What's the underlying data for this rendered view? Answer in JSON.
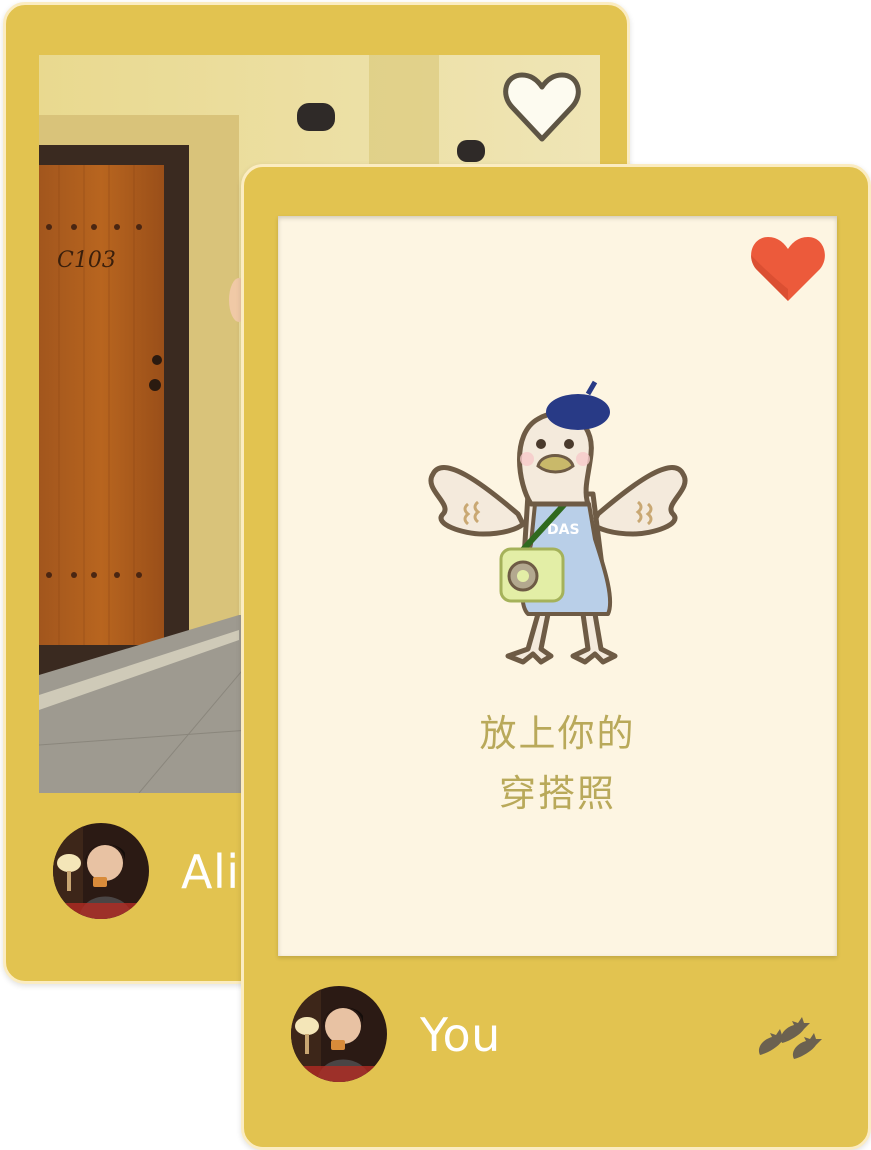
{
  "cards": [
    {
      "username": "Ali",
      "liked": false,
      "photo": "door-photo",
      "door_number": "C103"
    },
    {
      "username": "You",
      "liked": true,
      "placeholder_line1": "放上你的",
      "placeholder_line2": "穿搭照"
    }
  ],
  "colors": {
    "card_background": "#e2c350",
    "card_border": "#fbecc1",
    "liked_heart": "#ec5a3b",
    "unliked_heart": "#fdfbf0",
    "placeholder_text": "#b9a95a"
  }
}
